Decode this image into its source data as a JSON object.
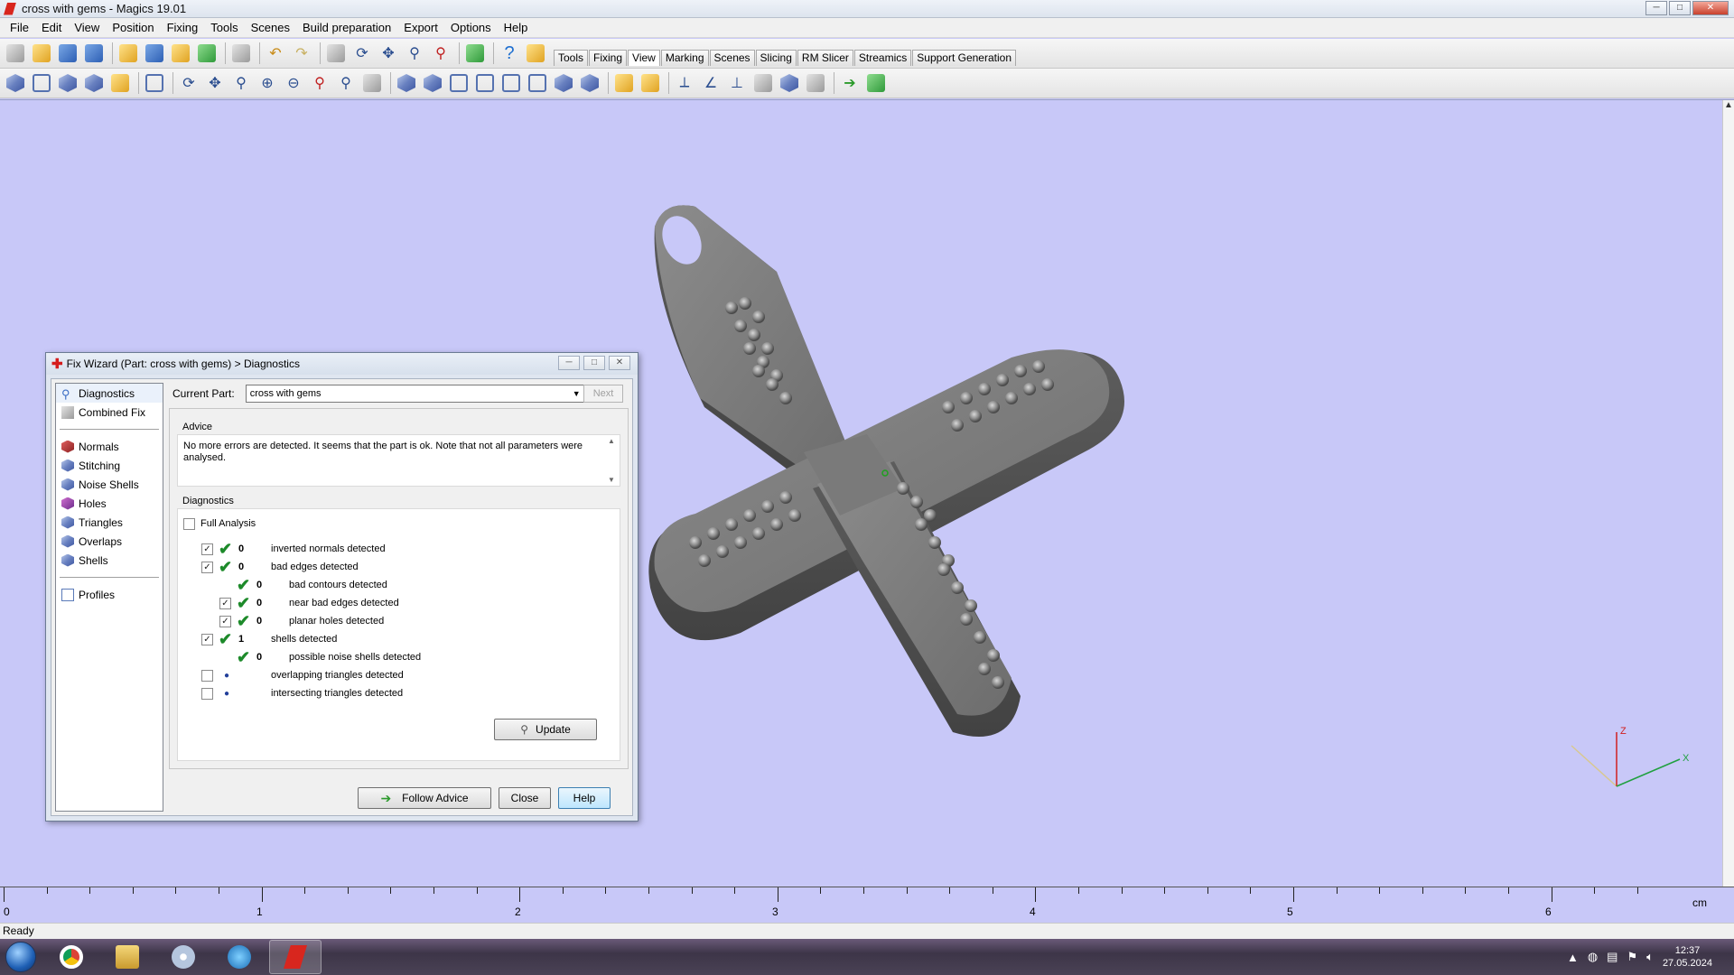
{
  "window": {
    "title": "cross with gems - Magics 19.01"
  },
  "menubar": [
    "File",
    "Edit",
    "View",
    "Position",
    "Fixing",
    "Tools",
    "Scenes",
    "Build preparation",
    "Export",
    "Options",
    "Help"
  ],
  "tabs": [
    "Tools",
    "Fixing",
    "View",
    "Marking",
    "Scenes",
    "Slicing",
    "RM Slicer",
    "Streamics",
    "Support Generation"
  ],
  "active_tab": "View",
  "dialog": {
    "title": "Fix Wizard (Part: cross with gems) > Diagnostics",
    "nav": {
      "top": [
        "Diagnostics",
        "Combined Fix"
      ],
      "middle": [
        "Normals",
        "Stitching",
        "Noise Shells",
        "Holes",
        "Triangles",
        "Overlaps",
        "Shells"
      ],
      "bottom": [
        "Profiles"
      ]
    },
    "current_part_label": "Current Part:",
    "current_part_value": "cross with gems",
    "next_label": "Next",
    "advice_label": "Advice",
    "advice_text": "No more errors are detected. It seems that the part is ok. Note that not all parameters were analysed.",
    "diagnostics_label": "Diagnostics",
    "full_analysis_label": "Full Analysis",
    "rows": [
      {
        "count": "0",
        "label": "inverted normals detected"
      },
      {
        "count": "0",
        "label": "bad edges detected"
      },
      {
        "count": "0",
        "label": "bad contours detected"
      },
      {
        "count": "0",
        "label": "near bad edges detected"
      },
      {
        "count": "0",
        "label": "planar holes detected"
      },
      {
        "count": "1",
        "label": "shells detected"
      },
      {
        "count": "0",
        "label": "possible noise shells detected"
      },
      {
        "count": "",
        "label": "overlapping triangles detected"
      },
      {
        "count": "",
        "label": "intersecting triangles detected"
      }
    ],
    "update_label": "Update",
    "follow_advice_label": "Follow Advice",
    "close_label": "Close",
    "help_label": "Help"
  },
  "axis": {
    "z": "Z",
    "x": "X"
  },
  "ruler": {
    "labels": [
      "0",
      "1",
      "2",
      "3",
      "4",
      "5",
      "6"
    ],
    "unit": "cm"
  },
  "status": "Ready",
  "taskbar": {
    "time": "12:37",
    "date": "27.05.2024"
  }
}
